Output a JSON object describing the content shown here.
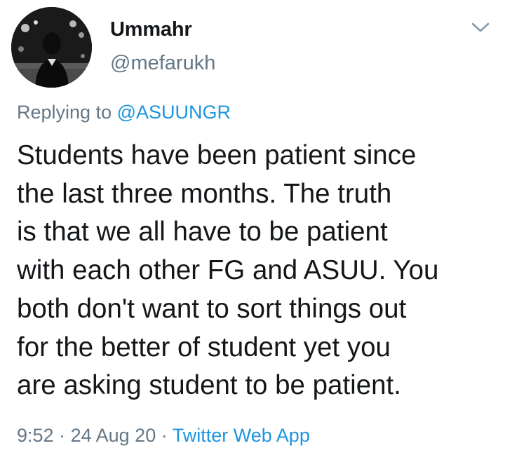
{
  "tweet": {
    "author": {
      "display_name": "Ummahr",
      "handle": "@mefarukh",
      "avatar_icon": "profile-avatar"
    },
    "menu_icon": "chevron-down-icon",
    "reply_prefix": "Replying to",
    "reply_mention": "@ASUUNGR",
    "text_lines": [
      "Students have been patient since",
      "the last three months. The truth",
      "is that we all have to be patient",
      "with each other FG and ASUU. You",
      "both don't want to sort things out",
      "for the better of student yet you",
      "are asking student to be patient."
    ],
    "time": "9:52",
    "separator": "·",
    "date": "24 Aug 20",
    "source": "Twitter Web App"
  },
  "colors": {
    "text": "#14171a",
    "secondary": "#657786",
    "link": "#1b95e0",
    "background": "#ffffff"
  }
}
